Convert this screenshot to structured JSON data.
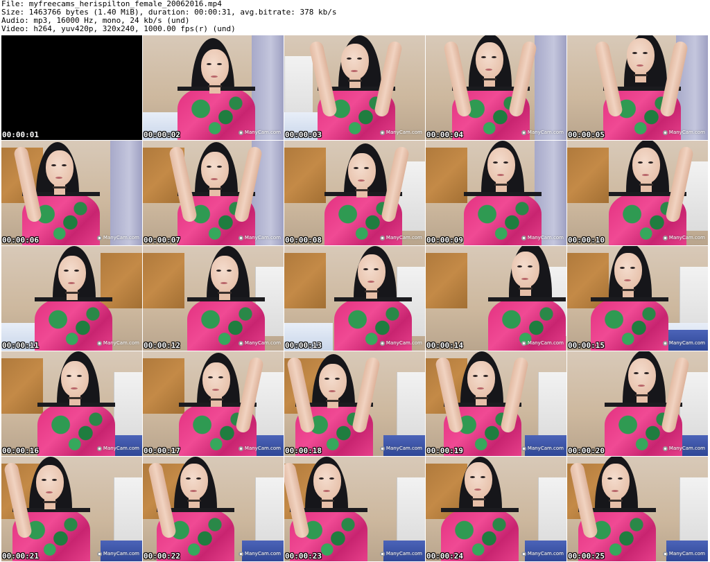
{
  "header": {
    "file_line": "File: myfreecams_herispilton_female_20062016.mp4",
    "size_line": "Size: 1463766 bytes (1.40 MiB), duration: 00:00:31, avg.bitrate: 378 kb/s",
    "audio_line": "Audio: mp3, 16000 Hz, mono, 24 kb/s (und)",
    "video_line": "Video: h264, yuv420p, 320x240, 1000.00 fps(r) (und)"
  },
  "watermark_text": "ManyCam.com",
  "frames": [
    {
      "timestamp": "00:00:01",
      "black": true
    },
    {
      "timestamp": "00:00:02"
    },
    {
      "timestamp": "00:00:03"
    },
    {
      "timestamp": "00:00:04"
    },
    {
      "timestamp": "00:00:05"
    },
    {
      "timestamp": "00:00:06"
    },
    {
      "timestamp": "00:00:07"
    },
    {
      "timestamp": "00:00:08"
    },
    {
      "timestamp": "00:00:09"
    },
    {
      "timestamp": "00:00:10"
    },
    {
      "timestamp": "00:00:11"
    },
    {
      "timestamp": "00:00:12"
    },
    {
      "timestamp": "00:00:13"
    },
    {
      "timestamp": "00:00:14"
    },
    {
      "timestamp": "00:00:15"
    },
    {
      "timestamp": "00:00:16"
    },
    {
      "timestamp": "00:00:17"
    },
    {
      "timestamp": "00:00:18"
    },
    {
      "timestamp": "00:00:19"
    },
    {
      "timestamp": "00:00:20"
    },
    {
      "timestamp": "00:00:21"
    },
    {
      "timestamp": "00:00:22"
    },
    {
      "timestamp": "00:00:23"
    },
    {
      "timestamp": "00:00:24"
    },
    {
      "timestamp": "00:00:25"
    }
  ]
}
